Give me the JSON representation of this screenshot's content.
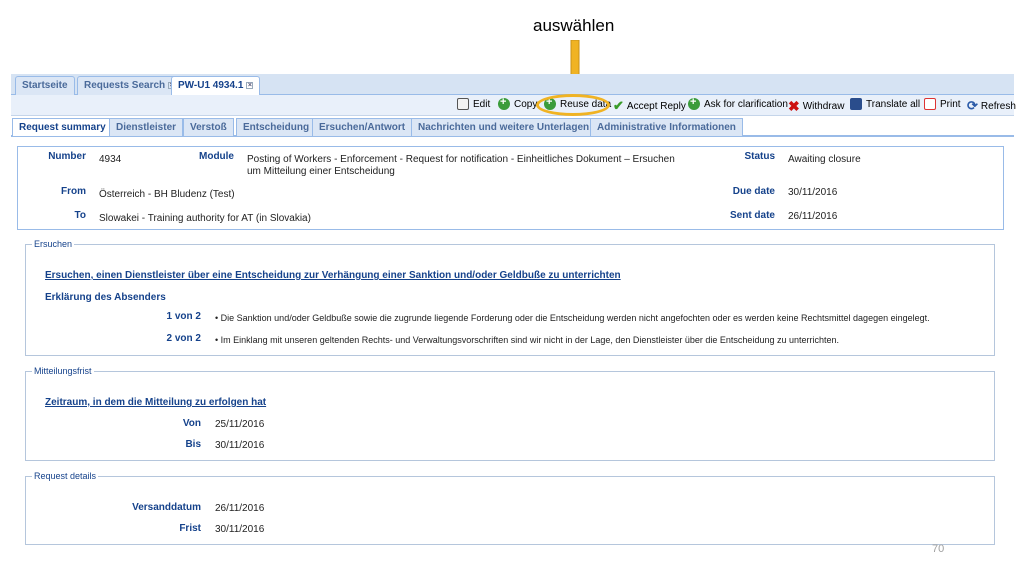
{
  "annotation": {
    "text": "auswählen",
    "arrow_color": "#f0b323"
  },
  "tabs": [
    {
      "label": "Startseite",
      "closable": false
    },
    {
      "label": "Requests Search",
      "closable": true
    },
    {
      "label": "PW-U1 4934.1",
      "closable": true,
      "active": true
    }
  ],
  "toolbar": {
    "edit": "Edit",
    "copy": "Copy",
    "reuse": "Reuse data",
    "accept": "Accept Reply",
    "clarify": "Ask for clarification",
    "withdraw": "Withdraw",
    "translate": "Translate all",
    "print": "Print",
    "refresh": "Refresh"
  },
  "subtabs": [
    "Request summary",
    "Dienstleister",
    "Verstoß",
    "Entscheidung",
    "Ersuchen/Antwort",
    "Nachrichten und weitere Unterlagen",
    "Administrative Informationen"
  ],
  "summary": {
    "number_label": "Number",
    "number": "4934",
    "module_label": "Module",
    "module": "Posting of Workers - Enforcement - Request for notification - Einheitliches Dokument – Ersuchen um Mitteilung einer Entscheidung",
    "status_label": "Status",
    "status": "Awaiting closure",
    "from_label": "From",
    "from": "Österreich - BH Bludenz (Test)",
    "due_label": "Due date",
    "due": "30/11/2016",
    "to_label": "To",
    "to": "Slowakei - Training authority for AT (in Slovakia)",
    "sent_label": "Sent date",
    "sent": "26/11/2016"
  },
  "ersuchen": {
    "legend": "Ersuchen",
    "title": "Ersuchen, einen Dienstleister über eine Entscheidung zur Verhängung einer Sanktion und/oder Geldbuße zu unterrichten",
    "declaration": "Erklärung des Absenders",
    "items": [
      {
        "label": "1 von 2",
        "text": "• Die Sanktion und/oder Geldbuße sowie die zugrunde liegende Forderung oder die Entscheidung werden nicht angefochten oder es werden keine Rechtsmittel dagegen eingelegt."
      },
      {
        "label": "2 von 2",
        "text": "• Im Einklang mit unseren geltenden Rechts- und Verwaltungsvorschriften sind wir nicht in der Lage, den Dienstleister über die Entscheidung zu unterrichten."
      }
    ]
  },
  "mitteilungsfrist": {
    "legend": "Mitteilungsfrist",
    "title": "Zeitraum, in dem die Mitteilung zu erfolgen hat",
    "von_label": "Von",
    "von": "25/11/2016",
    "bis_label": "Bis",
    "bis": "30/11/2016"
  },
  "request_details": {
    "legend": "Request details",
    "versand_label": "Versanddatum",
    "versand": "26/11/2016",
    "frist_label": "Frist",
    "frist": "30/11/2016"
  },
  "page_number": "70"
}
